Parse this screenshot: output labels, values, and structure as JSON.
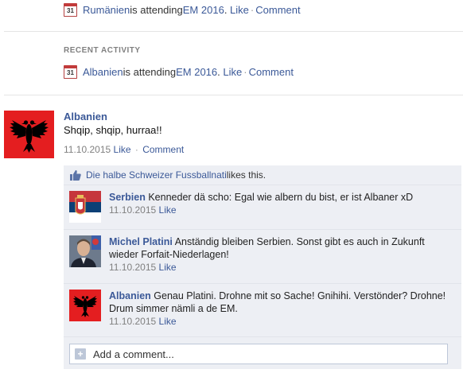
{
  "activity_top": {
    "calendar_day": "31",
    "subject": "Rumänien",
    "verb": " is attending ",
    "event": "EM 2016",
    "like": "Like",
    "comment": "Comment"
  },
  "recent": {
    "header": "Recent Activity",
    "calendar_day": "31",
    "subject": "Albanien",
    "verb": " is attending ",
    "event": "EM 2016",
    "like": "Like",
    "comment": "Comment"
  },
  "post": {
    "author": "Albanien",
    "text": "Shqip, shqip, hurraa!!",
    "date": "11.10.2015",
    "like": "Like",
    "comment": "Comment"
  },
  "likes": {
    "page": "Die halbe Schweizer Fussballnati",
    "suffix": " likes this."
  },
  "comments": [
    {
      "author": "Serbien",
      "text": "Kenneder dä scho: Egal wie albern du bist, er ist Albaner xD",
      "date": "11.10.2015",
      "like": "Like"
    },
    {
      "author": "Michel Platini",
      "text": "Anständig bleiben Serbien. Sonst gibt es auch in Zukunft wieder Forfait-Niederlagen!",
      "date": "11.10.2015",
      "like": "Like"
    },
    {
      "author": "Albanien",
      "text": "Genau Platini. Drohne mit so Sache! Gnihihi. Verstönder? Drohne! Drum simmer nämli a de EM.",
      "date": "11.10.2015",
      "like": "Like"
    }
  ],
  "add_comment": {
    "placeholder": "Add a comment..."
  },
  "colors": {
    "link": "#3b5998",
    "ufi_bg": "#edeff4",
    "albania_red": "#e41e20",
    "serbia_red": "#c6363c",
    "serbia_blue": "#0c4076"
  },
  "icons": [
    "calendar-icon",
    "like-thumb-icon",
    "plus-icon"
  ]
}
